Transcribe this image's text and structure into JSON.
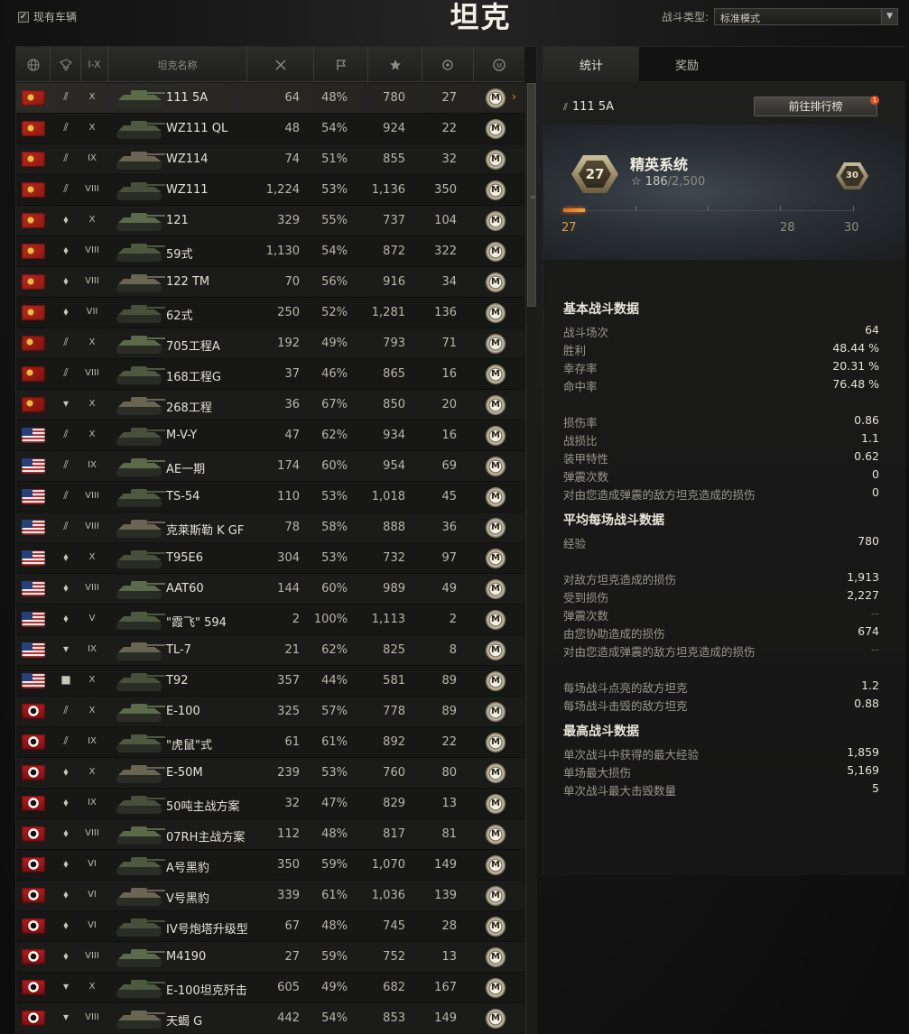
{
  "header": {
    "owned_label": "现有车辆",
    "title": "坦克",
    "battle_type_label": "战斗类型:",
    "battle_type_value": "标准模式"
  },
  "table": {
    "columns": [
      "",
      "",
      "I-X",
      "坦克名称",
      "",
      "",
      "",
      "",
      ""
    ],
    "column_icons": [
      "globe-icon",
      "tank-type-icon",
      "tier",
      "name",
      "battles-icon",
      "wins-flag-icon",
      "avg-xp-star-icon",
      "frags-icon",
      "mastery-icon"
    ],
    "rows": [
      {
        "nation": "cn",
        "type": "heavy",
        "tier": "X",
        "name": "111 5A",
        "battles": "64",
        "wins": "48%",
        "xp": "780",
        "frags": "27",
        "selected": true
      },
      {
        "nation": "cn",
        "type": "heavy",
        "tier": "X",
        "name": "WZ111 QL",
        "battles": "48",
        "wins": "54%",
        "xp": "924",
        "frags": "22"
      },
      {
        "nation": "cn",
        "type": "heavy",
        "tier": "IX",
        "name": "WZ114",
        "battles": "74",
        "wins": "51%",
        "xp": "855",
        "frags": "32"
      },
      {
        "nation": "cn",
        "type": "heavy",
        "tier": "VIII",
        "name": "WZ111",
        "battles": "1,224",
        "wins": "53%",
        "xp": "1,136",
        "frags": "350"
      },
      {
        "nation": "cn",
        "type": "medium",
        "tier": "X",
        "name": "121",
        "battles": "329",
        "wins": "55%",
        "xp": "737",
        "frags": "104"
      },
      {
        "nation": "cn",
        "type": "medium",
        "tier": "VIII",
        "name": "59式",
        "battles": "1,130",
        "wins": "54%",
        "xp": "872",
        "frags": "322"
      },
      {
        "nation": "cn",
        "type": "medium",
        "tier": "VIII",
        "name": "122 TM",
        "battles": "70",
        "wins": "56%",
        "xp": "916",
        "frags": "34"
      },
      {
        "nation": "cn",
        "type": "medium",
        "tier": "VII",
        "name": "62式",
        "battles": "250",
        "wins": "52%",
        "xp": "1,281",
        "frags": "136"
      },
      {
        "nation": "ussr",
        "type": "heavy",
        "tier": "X",
        "name": "705工程A",
        "battles": "192",
        "wins": "49%",
        "xp": "793",
        "frags": "71"
      },
      {
        "nation": "ussr",
        "type": "heavy",
        "tier": "VIII",
        "name": "168工程G",
        "battles": "37",
        "wins": "46%",
        "xp": "865",
        "frags": "16"
      },
      {
        "nation": "ussr",
        "type": "td",
        "tier": "X",
        "name": "268工程",
        "battles": "36",
        "wins": "67%",
        "xp": "850",
        "frags": "20"
      },
      {
        "nation": "us",
        "type": "heavy",
        "tier": "X",
        "name": "M-V-Y",
        "battles": "47",
        "wins": "62%",
        "xp": "934",
        "frags": "16"
      },
      {
        "nation": "us",
        "type": "heavy",
        "tier": "IX",
        "name": "AE一期",
        "battles": "174",
        "wins": "60%",
        "xp": "954",
        "frags": "69"
      },
      {
        "nation": "us",
        "type": "heavy",
        "tier": "VIII",
        "name": "TS-54",
        "battles": "110",
        "wins": "53%",
        "xp": "1,018",
        "frags": "45"
      },
      {
        "nation": "us",
        "type": "heavy",
        "tier": "VIII",
        "name": "克莱斯勒 K GF",
        "battles": "78",
        "wins": "58%",
        "xp": "888",
        "frags": "36"
      },
      {
        "nation": "us",
        "type": "medium",
        "tier": "X",
        "name": "T95E6",
        "battles": "304",
        "wins": "53%",
        "xp": "732",
        "frags": "97"
      },
      {
        "nation": "us",
        "type": "medium",
        "tier": "VIII",
        "name": "AAT60",
        "battles": "144",
        "wins": "60%",
        "xp": "989",
        "frags": "49"
      },
      {
        "nation": "us",
        "type": "medium",
        "tier": "V",
        "name": "\"霞飞\" 594",
        "battles": "2",
        "wins": "100%",
        "xp": "1,113",
        "frags": "2"
      },
      {
        "nation": "us",
        "type": "td",
        "tier": "IX",
        "name": "TL-7",
        "battles": "21",
        "wins": "62%",
        "xp": "825",
        "frags": "8"
      },
      {
        "nation": "us",
        "type": "spg",
        "tier": "X",
        "name": "T92",
        "battles": "357",
        "wins": "44%",
        "xp": "581",
        "frags": "89"
      },
      {
        "nation": "de",
        "type": "heavy",
        "tier": "X",
        "name": "E-100",
        "battles": "325",
        "wins": "57%",
        "xp": "778",
        "frags": "89"
      },
      {
        "nation": "de",
        "type": "heavy",
        "tier": "IX",
        "name": "\"虎鼠\"式",
        "battles": "61",
        "wins": "61%",
        "xp": "892",
        "frags": "22"
      },
      {
        "nation": "de",
        "type": "medium",
        "tier": "X",
        "name": "E-50M",
        "battles": "239",
        "wins": "53%",
        "xp": "760",
        "frags": "80"
      },
      {
        "nation": "de",
        "type": "medium",
        "tier": "IX",
        "name": "50吨主战方案",
        "battles": "32",
        "wins": "47%",
        "xp": "829",
        "frags": "13"
      },
      {
        "nation": "de",
        "type": "medium",
        "tier": "VIII",
        "name": "07RH主战方案",
        "battles": "112",
        "wins": "48%",
        "xp": "817",
        "frags": "81"
      },
      {
        "nation": "de",
        "type": "medium",
        "tier": "VI",
        "name": "A号黑豹",
        "battles": "350",
        "wins": "59%",
        "xp": "1,070",
        "frags": "149"
      },
      {
        "nation": "de",
        "type": "medium",
        "tier": "VI",
        "name": "V号黑豹",
        "battles": "339",
        "wins": "61%",
        "xp": "1,036",
        "frags": "139"
      },
      {
        "nation": "de",
        "type": "medium",
        "tier": "VI",
        "name": "IV号炮塔升级型",
        "battles": "67",
        "wins": "48%",
        "xp": "745",
        "frags": "28"
      },
      {
        "nation": "de",
        "type": "medium",
        "tier": "VIII",
        "name": "M4190",
        "battles": "27",
        "wins": "59%",
        "xp": "752",
        "frags": "13"
      },
      {
        "nation": "de",
        "type": "td",
        "tier": "X",
        "name": "E-100坦克歼击",
        "battles": "605",
        "wins": "49%",
        "xp": "682",
        "frags": "167"
      },
      {
        "nation": "de",
        "type": "td",
        "tier": "VIII",
        "name": "天蝎 G",
        "battles": "442",
        "wins": "54%",
        "xp": "853",
        "frags": "149"
      }
    ],
    "mastery_label": "M"
  },
  "right": {
    "tabs": [
      "统计",
      "奖励"
    ],
    "selected_tank": "111 5A",
    "leaderboard_button": "前往排行榜",
    "notification_count": "1",
    "elite": {
      "level": "27",
      "title": "精英系统",
      "xp": "186",
      "xp_total": "/2,500",
      "max_level": "30",
      "progress": 0.074,
      "labels": {
        "current": "27",
        "next": "28",
        "max": "30"
      }
    },
    "sections": [
      {
        "title": "基本战斗数据",
        "rows": [
          [
            "战斗场次",
            "64"
          ],
          [
            "胜利",
            "48.44 %"
          ],
          [
            "幸存率",
            "20.31 %"
          ],
          [
            "命中率",
            "76.48 %"
          ],
          null,
          [
            "损伤率",
            "0.86"
          ],
          [
            "战损比",
            "1.1"
          ],
          [
            "装甲特性",
            "0.62"
          ],
          [
            "弹震次数",
            "0"
          ],
          [
            "对由您造成弹震的敌方坦克造成的损伤",
            "0"
          ]
        ]
      },
      {
        "title": "平均每场战斗数据",
        "rows": [
          [
            "经验",
            "780"
          ],
          null,
          [
            "对敌方坦克造成的损伤",
            "1,913"
          ],
          [
            "受到损伤",
            "2,227"
          ],
          [
            "弹震次数",
            "--"
          ],
          [
            "由您协助造成的损伤",
            "674"
          ],
          [
            "对由您造成弹震的敌方坦克造成的损伤",
            "--"
          ],
          null,
          [
            "每场战斗点亮的敌方坦克",
            "1.2"
          ],
          [
            "每场战斗击毁的敌方坦克",
            "0.88"
          ]
        ]
      },
      {
        "title": "最高战斗数据",
        "rows": [
          [
            "单次战斗中获得的最大经验",
            "1,859"
          ],
          [
            "单场最大损伤",
            "5,169"
          ],
          [
            "单次战斗最大击毁数量",
            "5"
          ]
        ]
      }
    ]
  },
  "colors": {
    "accent": "#f19a2f",
    "text": "#e4e1d5",
    "dim": "#9a978c"
  }
}
